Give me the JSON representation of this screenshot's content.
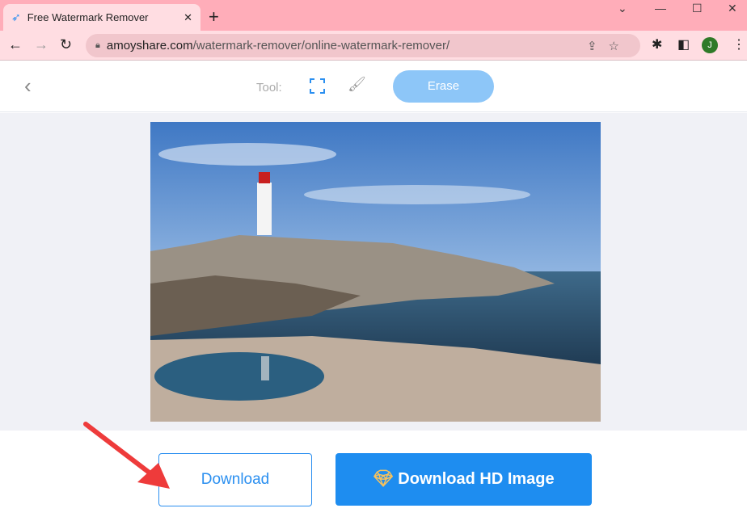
{
  "browser": {
    "tab_title": "Free Watermark Remover Online",
    "url_host": "amoyshare.com",
    "url_path": "/watermark-remover/online-watermark-remover/",
    "profile_initial": "J"
  },
  "app": {
    "tool_label": "Tool:",
    "tools": [
      "rectangle-select-icon",
      "brush-icon"
    ],
    "erase_label": "Erase",
    "download_label": "Download",
    "download_hd_label": "Download HD Image",
    "accent": "#1e8df0"
  }
}
